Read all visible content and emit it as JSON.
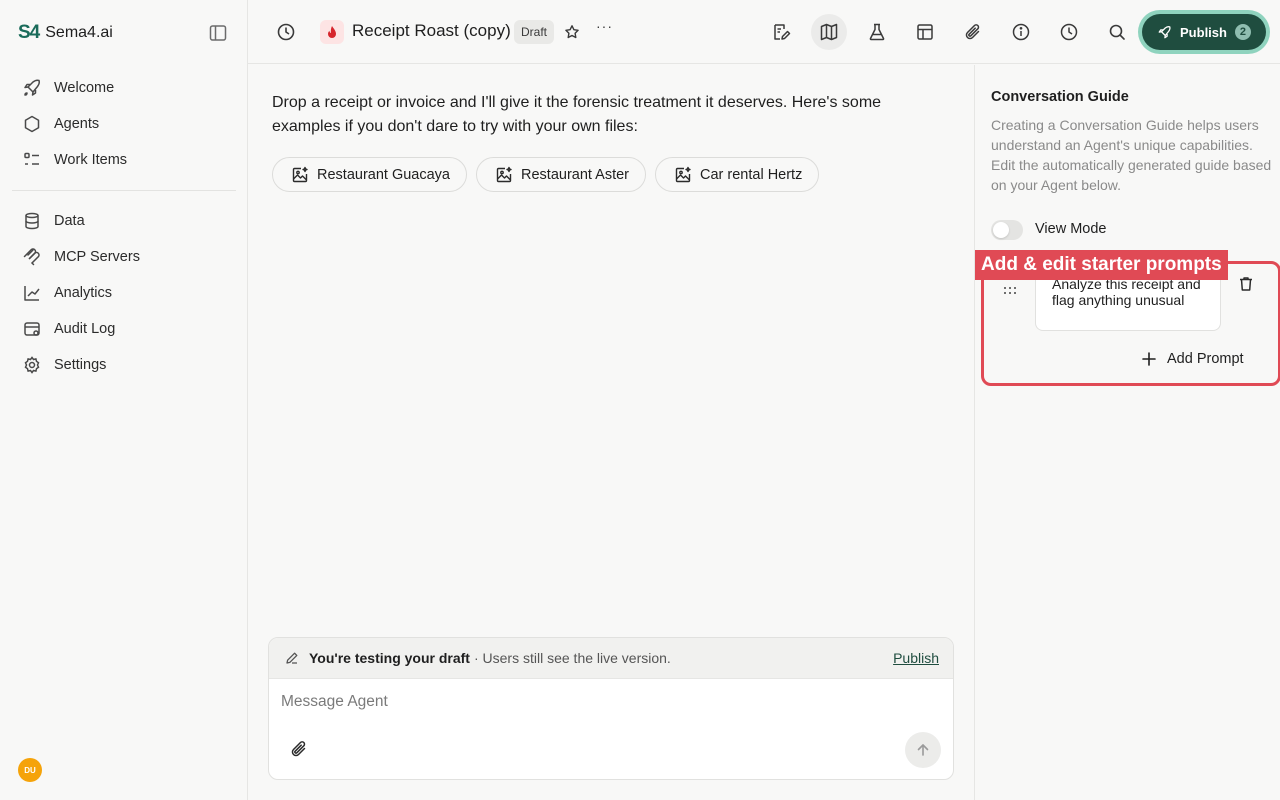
{
  "brand": {
    "logo": "S4",
    "name": "Sema4.ai"
  },
  "sidebar": {
    "primary": [
      {
        "label": "Welcome",
        "icon": "rocket-icon"
      },
      {
        "label": "Agents",
        "icon": "hexagon-icon"
      },
      {
        "label": "Work Items",
        "icon": "list-icon"
      }
    ],
    "secondary": [
      {
        "label": "Data",
        "icon": "database-icon"
      },
      {
        "label": "MCP Servers",
        "icon": "mcp-icon"
      },
      {
        "label": "Analytics",
        "icon": "chart-icon"
      },
      {
        "label": "Audit Log",
        "icon": "audit-icon"
      },
      {
        "label": "Settings",
        "icon": "gear-icon"
      }
    ],
    "user_initials": "DU"
  },
  "topbar": {
    "agent_title": "Receipt Roast (copy)",
    "status_badge": "Draft",
    "more": "···",
    "publish_label": "Publish",
    "publish_count": "2"
  },
  "main": {
    "intro": "Drop a receipt or invoice and I'll give it the forensic treatment it deserves. Here's some examples if you don't dare to try with your own files:",
    "examples": [
      {
        "label": "Restaurant Guacaya"
      },
      {
        "label": "Restaurant Aster"
      },
      {
        "label": "Car rental Hertz"
      }
    ]
  },
  "composer": {
    "draft_notice_bold": "You're testing your draft",
    "draft_notice_rest": "· Users still see the live version.",
    "draft_publish": "Publish",
    "placeholder": "Message Agent"
  },
  "panel": {
    "title": "Conversation Guide",
    "description": "Creating a Conversation Guide helps users understand an Agent's unique capabilities. Edit the automatically generated guide based on your Agent below.",
    "view_mode_label": "View Mode",
    "view_mode_on": false,
    "annotation_label": "Add & edit starter prompts",
    "prompts": [
      {
        "text": "Analyze this receipt and flag anything unusual"
      }
    ],
    "add_prompt_label": "Add Prompt"
  },
  "colors": {
    "brand": "#1a6b5a",
    "publish_bg": "#1f4d3f",
    "publish_glow": "#8fd3be",
    "annotation": "#e04a55",
    "avatar": "#f5a30a"
  }
}
